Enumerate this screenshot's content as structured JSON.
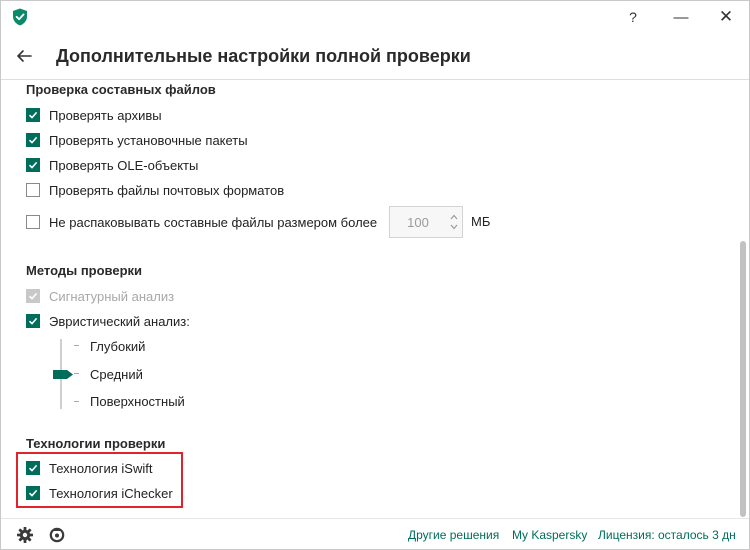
{
  "colors": {
    "accent": "#006d5b",
    "highlight": "#e0232d"
  },
  "window": {
    "help": "?",
    "minimize": "—",
    "close": "✕",
    "app_icon": "kaspersky-shield-icon"
  },
  "header": {
    "back_icon": "back-arrow-icon",
    "title": "Дополнительные настройки полной проверки"
  },
  "compound": {
    "title": "Проверка составных файлов",
    "options": [
      {
        "label": "Проверять архивы",
        "checked": true
      },
      {
        "label": "Проверять установочные пакеты",
        "checked": true
      },
      {
        "label": "Проверять OLE-объекты",
        "checked": true
      },
      {
        "label": "Проверять файлы почтовых форматов",
        "checked": false
      },
      {
        "label": "Не распаковывать составные файлы размером более",
        "checked": false
      }
    ],
    "size_value": "100",
    "size_unit": "МБ"
  },
  "methods": {
    "title": "Методы проверки",
    "signature": {
      "label": "Сигнатурный анализ",
      "checked": true,
      "disabled": true
    },
    "heuristic": {
      "label": "Эвристический анализ:",
      "checked": true
    },
    "levels": [
      "Глубокий",
      "Средний",
      "Поверхностный"
    ],
    "selected_level": "Средний"
  },
  "technologies": {
    "title": "Технологии проверки",
    "options": [
      {
        "label": "Технология iSwift",
        "checked": true
      },
      {
        "label": "Технология iChecker",
        "checked": true
      }
    ]
  },
  "footer": {
    "settings_icon": "gear-icon",
    "support_icon": "support-icon",
    "links": [
      "Другие решения",
      "My Kaspersky",
      "Лицензия: осталось 3 дн"
    ]
  }
}
